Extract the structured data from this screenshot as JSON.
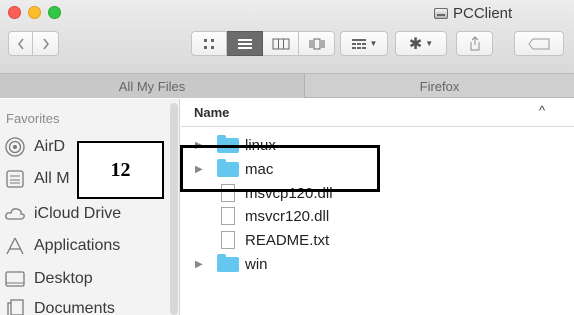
{
  "window": {
    "title": "PCClient"
  },
  "tabs": [
    {
      "label": "All My Files"
    },
    {
      "label": "Firefox"
    }
  ],
  "sidebar": {
    "heading": "Favorites",
    "items": [
      {
        "label": "AirD",
        "icon": "airdrop-icon"
      },
      {
        "label": "All M",
        "icon": "all-my-files-icon"
      },
      {
        "label": "iCloud Drive",
        "icon": "cloud-icon"
      },
      {
        "label": "Applications",
        "icon": "applications-icon"
      },
      {
        "label": "Desktop",
        "icon": "desktop-icon"
      },
      {
        "label": "Documents",
        "icon": "documents-icon"
      }
    ]
  },
  "list": {
    "column_name": "Name",
    "sort_indicator": "^",
    "rows": [
      {
        "name": "linux",
        "type": "folder",
        "expandable": true
      },
      {
        "name": "mac",
        "type": "folder",
        "expandable": true
      },
      {
        "name": "msvcp120.dll",
        "type": "file",
        "expandable": false
      },
      {
        "name": "msvcr120.dll",
        "type": "file",
        "expandable": false
      },
      {
        "name": "README.txt",
        "type": "file",
        "expandable": false
      },
      {
        "name": "win",
        "type": "folder",
        "expandable": true
      }
    ]
  },
  "annotation": {
    "label": "12"
  },
  "colors": {
    "folder": "#65c7f0",
    "sidebar_bg": "#f3f3f3",
    "toolbar_bg": "#dddddd",
    "active_view": "#6c6c6c"
  }
}
